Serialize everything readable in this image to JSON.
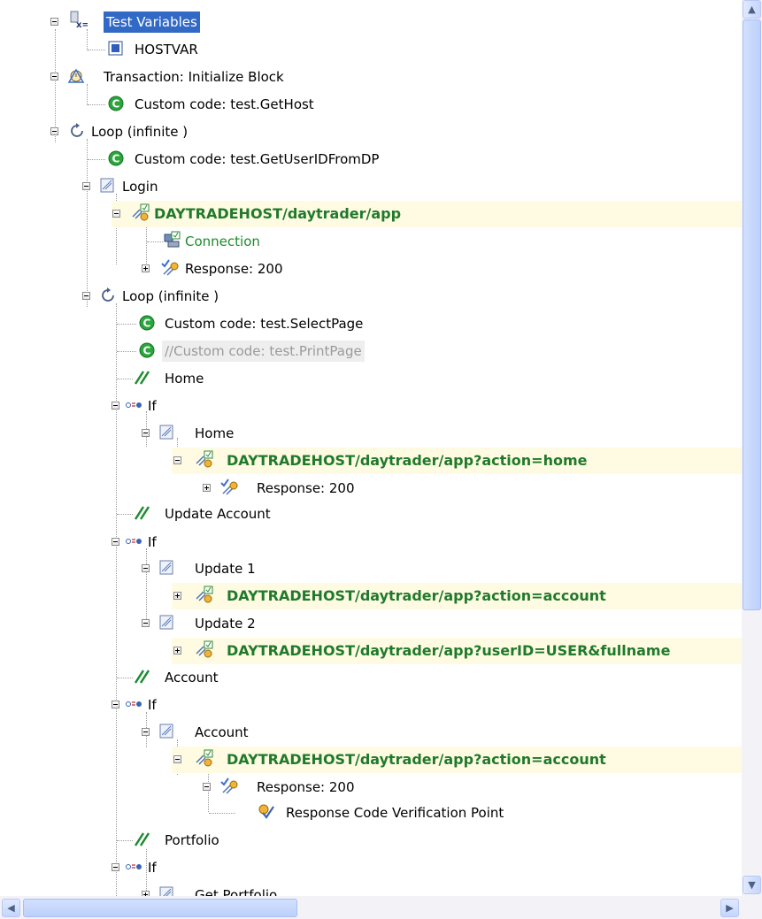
{
  "tree": {
    "nodes": [
      {
        "label": "Test Variables",
        "icon": "test-variables-icon"
      },
      {
        "label": "HOSTVAR",
        "icon": "variable-icon"
      },
      {
        "label": "Transaction: Initialize Block",
        "icon": "transaction-icon"
      },
      {
        "label": "Custom code: test.GetHost",
        "icon": "custom-code-icon"
      },
      {
        "label": "Loop (infinite )",
        "icon": "loop-icon"
      },
      {
        "label": "Custom code: test.GetUserIDFromDP",
        "icon": "custom-code-icon"
      },
      {
        "label": "Login",
        "icon": "page-icon"
      },
      {
        "label": "DAYTRADEHOST/daytrader/app",
        "icon": "http-request-icon"
      },
      {
        "label": "Connection",
        "icon": "connection-icon"
      },
      {
        "label": "Response: 200",
        "icon": "response-icon"
      },
      {
        "label": "Loop (infinite )",
        "icon": "loop-icon"
      },
      {
        "label": "Custom code: test.SelectPage",
        "icon": "custom-code-icon"
      },
      {
        "label": "//Custom code: test.PrintPage",
        "icon": "custom-code-icon"
      },
      {
        "label": "Home",
        "icon": "comment-icon"
      },
      {
        "label": "If",
        "icon": "if-icon"
      },
      {
        "label": "Home",
        "icon": "page-icon"
      },
      {
        "label": "DAYTRADEHOST/daytrader/app?action=home",
        "icon": "http-request-icon"
      },
      {
        "label": "Response: 200",
        "icon": "response-icon"
      },
      {
        "label": "Update Account",
        "icon": "comment-icon"
      },
      {
        "label": "If",
        "icon": "if-icon"
      },
      {
        "label": "Update 1",
        "icon": "page-icon"
      },
      {
        "label": "DAYTRADEHOST/daytrader/app?action=account",
        "icon": "http-request-icon"
      },
      {
        "label": "Update 2",
        "icon": "page-icon"
      },
      {
        "label": "DAYTRADEHOST/daytrader/app?userID=USER&fullname",
        "icon": "http-request-icon"
      },
      {
        "label": "Account",
        "icon": "comment-icon"
      },
      {
        "label": "If",
        "icon": "if-icon"
      },
      {
        "label": "Account",
        "icon": "page-icon"
      },
      {
        "label": "DAYTRADEHOST/daytrader/app?action=account",
        "icon": "http-request-icon"
      },
      {
        "label": "Response: 200",
        "icon": "response-icon"
      },
      {
        "label": "Response Code Verification Point",
        "icon": "verification-point-icon"
      },
      {
        "label": "Portfolio",
        "icon": "comment-icon"
      },
      {
        "label": "If",
        "icon": "if-icon"
      },
      {
        "label": "Get Portfolio",
        "icon": "page-icon"
      }
    ]
  },
  "colors": {
    "selection": "#3169c6",
    "request_text": "#1f7a2b",
    "connection_text": "#1a8c2a",
    "disabled_text": "#9a9a9a"
  }
}
